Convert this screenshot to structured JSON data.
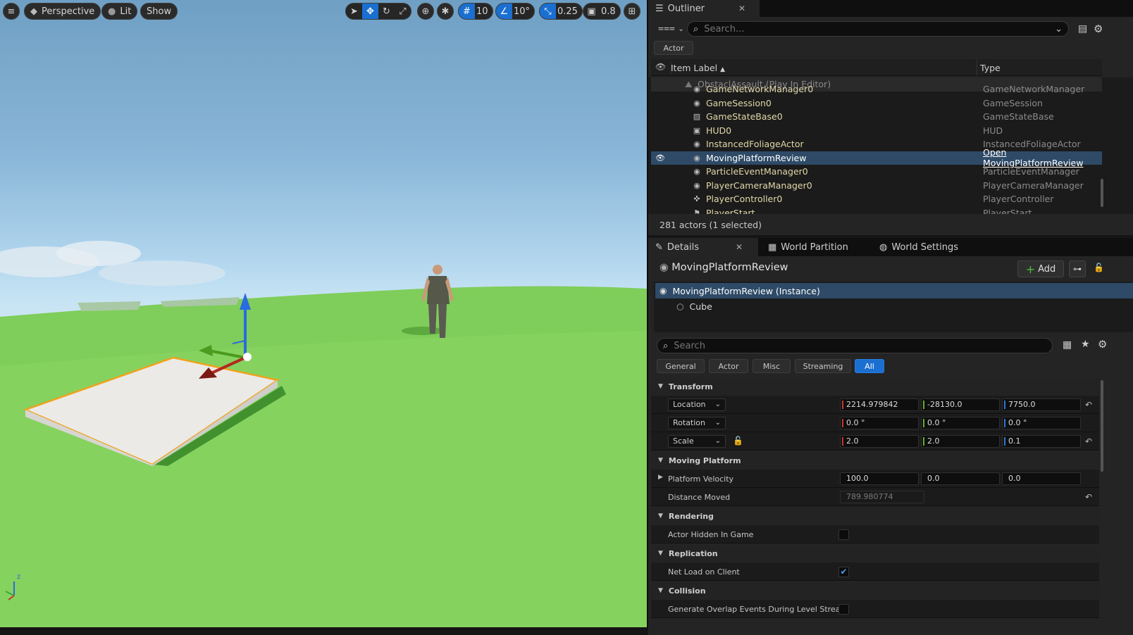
{
  "viewport": {
    "mode_label": "Perspective",
    "lit_label": "Lit",
    "show_label": "Show",
    "grid_snap": "10",
    "rotation_snap": "10°",
    "scale_snap": "0.25",
    "camera_speed": "0.8"
  },
  "outliner": {
    "tab_label": "Outliner",
    "search_placeholder": "Search...",
    "filter_chip": "Actor",
    "col_label": "Item Label",
    "col_type": "Type",
    "root": "ObstaclAssault (Play In Editor)",
    "rows": [
      {
        "label": "GameNetworkManager0",
        "type": "GameNetworkManager",
        "icon": "globe-icon"
      },
      {
        "label": "GameSession0",
        "type": "GameSession",
        "icon": "globe-icon"
      },
      {
        "label": "GameStateBase0",
        "type": "GameStateBase",
        "icon": "graph-icon"
      },
      {
        "label": "HUD0",
        "type": "HUD",
        "icon": "hud-icon"
      },
      {
        "label": "InstancedFoliageActor",
        "type": "InstancedFoliageActor",
        "icon": "globe-icon"
      },
      {
        "label": "MovingPlatformReview",
        "type": "Open MovingPlatformReview",
        "icon": "globe-icon",
        "selected": true
      },
      {
        "label": "ParticleEventManager0",
        "type": "ParticleEventManager",
        "icon": "globe-icon"
      },
      {
        "label": "PlayerCameraManager0",
        "type": "PlayerCameraManager",
        "icon": "globe-icon"
      },
      {
        "label": "PlayerController0",
        "type": "PlayerController",
        "icon": "gamepad-icon"
      },
      {
        "label": "PlayerStart",
        "type": "PlayerStart",
        "icon": "flag-icon"
      }
    ],
    "status": "281 actors (1 selected)"
  },
  "details": {
    "tabs": [
      "Details",
      "World Partition",
      "World Settings"
    ],
    "actor_name": "MovingPlatformReview",
    "add_label": "Add",
    "components": [
      "MovingPlatformReview (Instance)",
      "Cube"
    ],
    "search_placeholder": "Search",
    "filters": [
      "General",
      "Actor",
      "Misc",
      "Streaming",
      "All"
    ],
    "transform": {
      "header": "Transform",
      "location_label": "Location",
      "location": [
        "2214.979842",
        "-28130.0",
        "7750.0"
      ],
      "rotation_label": "Rotation",
      "rotation": [
        "0.0 °",
        "0.0 °",
        "0.0 °"
      ],
      "scale_label": "Scale",
      "scale": [
        "2.0",
        "2.0",
        "0.1"
      ]
    },
    "moving_platform": {
      "header": "Moving Platform",
      "velocity_label": "Platform Velocity",
      "velocity": [
        "100.0",
        "0.0",
        "0.0"
      ],
      "distance_label": "Distance Moved",
      "distance": "789.980774"
    },
    "rendering": {
      "header": "Rendering",
      "hidden_label": "Actor Hidden In Game",
      "hidden": false
    },
    "replication": {
      "header": "Replication",
      "net_load_label": "Net Load on Client",
      "net_load": true
    },
    "collision": {
      "header": "Collision",
      "overlap_label": "Generate Overlap Events During Level Stream"
    }
  }
}
